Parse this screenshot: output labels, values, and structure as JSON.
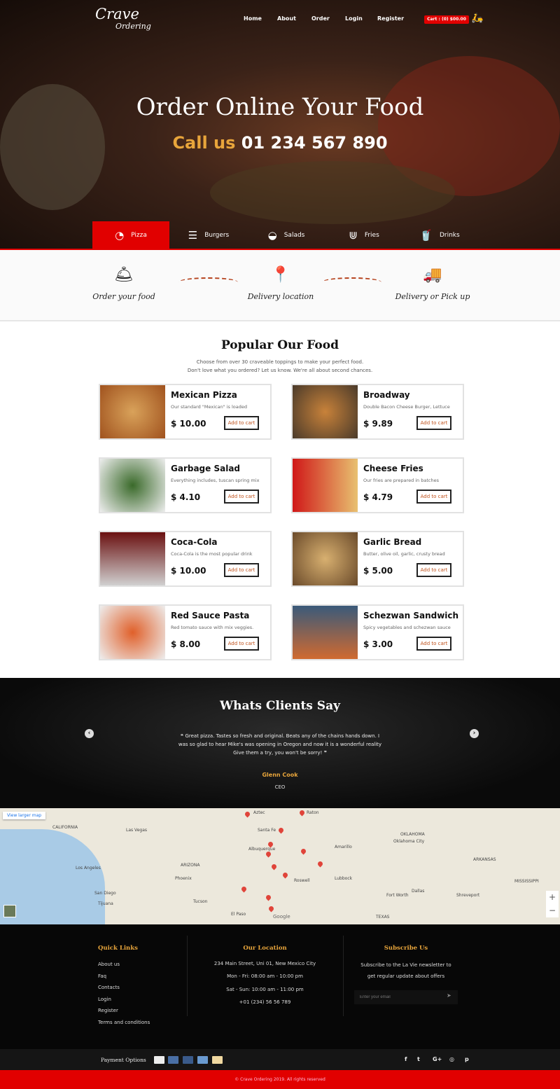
{
  "header": {
    "logo_line1": "Crave",
    "logo_line2": "Ordering",
    "nav": [
      "Home",
      "About",
      "Order",
      "Login",
      "Register"
    ],
    "cart": "Cart : (0) $00.00"
  },
  "hero": {
    "title": "Order Online Your Food",
    "call_label": "Call us",
    "phone": "01 234 567 890"
  },
  "categories": [
    {
      "label": "Pizza",
      "icon": "pizza-icon",
      "active": true
    },
    {
      "label": "Burgers",
      "icon": "burger-icon"
    },
    {
      "label": "Salads",
      "icon": "salad-icon"
    },
    {
      "label": "Fries",
      "icon": "fries-icon"
    },
    {
      "label": "Drinks",
      "icon": "drink-icon"
    }
  ],
  "steps": [
    {
      "label": "Order your food",
      "icon": "cloche-icon"
    },
    {
      "label": "Delivery location",
      "icon": "location-pin-icon"
    },
    {
      "label": "Delivery or Pick up",
      "icon": "delivery-truck-icon"
    }
  ],
  "popular": {
    "title": "Popular Our Food",
    "subtitle1": "Choose from over 30 craveable toppings to make your perfect food.",
    "subtitle2": "Don't love what you ordered? Let us know. We're all about second chances.",
    "add_label": "Add to cart",
    "items": [
      {
        "name": "Mexican Pizza",
        "desc": "Our standard \"Mexican\" is loaded",
        "price": "$ 10.00"
      },
      {
        "name": "Broadway",
        "desc": "Double Bacon Cheese Burger, Lettuce",
        "price": "$ 9.89"
      },
      {
        "name": "Garbage Salad",
        "desc": "Everything includes, tuscan spring mix",
        "price": "$ 4.10"
      },
      {
        "name": "Cheese Fries",
        "desc": "Our fries are prepared in batches",
        "price": "$ 4.79"
      },
      {
        "name": "Coca-Cola",
        "desc": "Coca-Cola is the most popular drink",
        "price": "$ 10.00"
      },
      {
        "name": "Garlic Bread",
        "desc": "Butter, olive oil, garlic, crusty bread",
        "price": "$ 5.00"
      },
      {
        "name": "Red Sauce Pasta",
        "desc": "Red tomato sauce with mix veggies.",
        "price": "$ 8.00"
      },
      {
        "name": "Schezwan Sandwich",
        "desc": "Spicy vegetables and schezwan sauce",
        "price": "$ 3.00"
      }
    ]
  },
  "testimonials": {
    "title": "Whats Clients Say",
    "quote": "Great pizza. Tastes so fresh and original. Beats any of the chains hands down. I was so glad to hear Mike's was opening in Oregon and now it is a wonderful reality Give them a try, you won't be sorry!",
    "author": "Glenn Cook",
    "role": "CEO"
  },
  "map": {
    "larger_map": "View larger map",
    "labels": [
      "CALIFORNIA",
      "Las Vegas",
      "Los Angeles",
      "San Diego",
      "Tijuana",
      "Phoenix",
      "Tucson",
      "ARIZONA",
      "Albuquerque",
      "Santa Fe",
      "Amarillo",
      "Lubbock",
      "OKLAHOMA",
      "Oklahoma City",
      "ARKANSAS",
      "Dallas",
      "Fort Worth",
      "TEXAS",
      "Shreveport",
      "MISSISSIPPI",
      "El Paso",
      "Raton",
      "Aztec",
      "Roswell"
    ],
    "google": "Google"
  },
  "footer": {
    "quick_links_title": "Quick Links",
    "quick_links": [
      "About us",
      "Faq",
      "Contacts",
      "Login",
      "Register",
      "Terms and conditions"
    ],
    "location_title": "Our Location",
    "location": [
      "234 Main Street, Uni 01, New Mexico City",
      "Mon - Fri: 08:00 am - 10:00 pm",
      "Sat - Sun: 10:00 am - 11:00 pm",
      "+01 (234) 56 56 789"
    ],
    "subscribe_title": "Subscribe Us",
    "subscribe_text1": "Subscribe to the La Vie newsletter to",
    "subscribe_text2": "get regular update about offers",
    "email_placeholder": "Enter your email"
  },
  "payment": {
    "label": "Payment Options",
    "cards": [
      "paypal",
      "mastercard",
      "maestro",
      "amex",
      "discover"
    ]
  },
  "social": [
    "facebook",
    "twitter",
    "google-plus",
    "instagram",
    "pinterest"
  ],
  "copyright": "© Crave Ordering 2019. All rights reserved",
  "colors": {
    "accent": "#e10000",
    "gold": "#e8a53b",
    "button_text": "#c0531e"
  }
}
